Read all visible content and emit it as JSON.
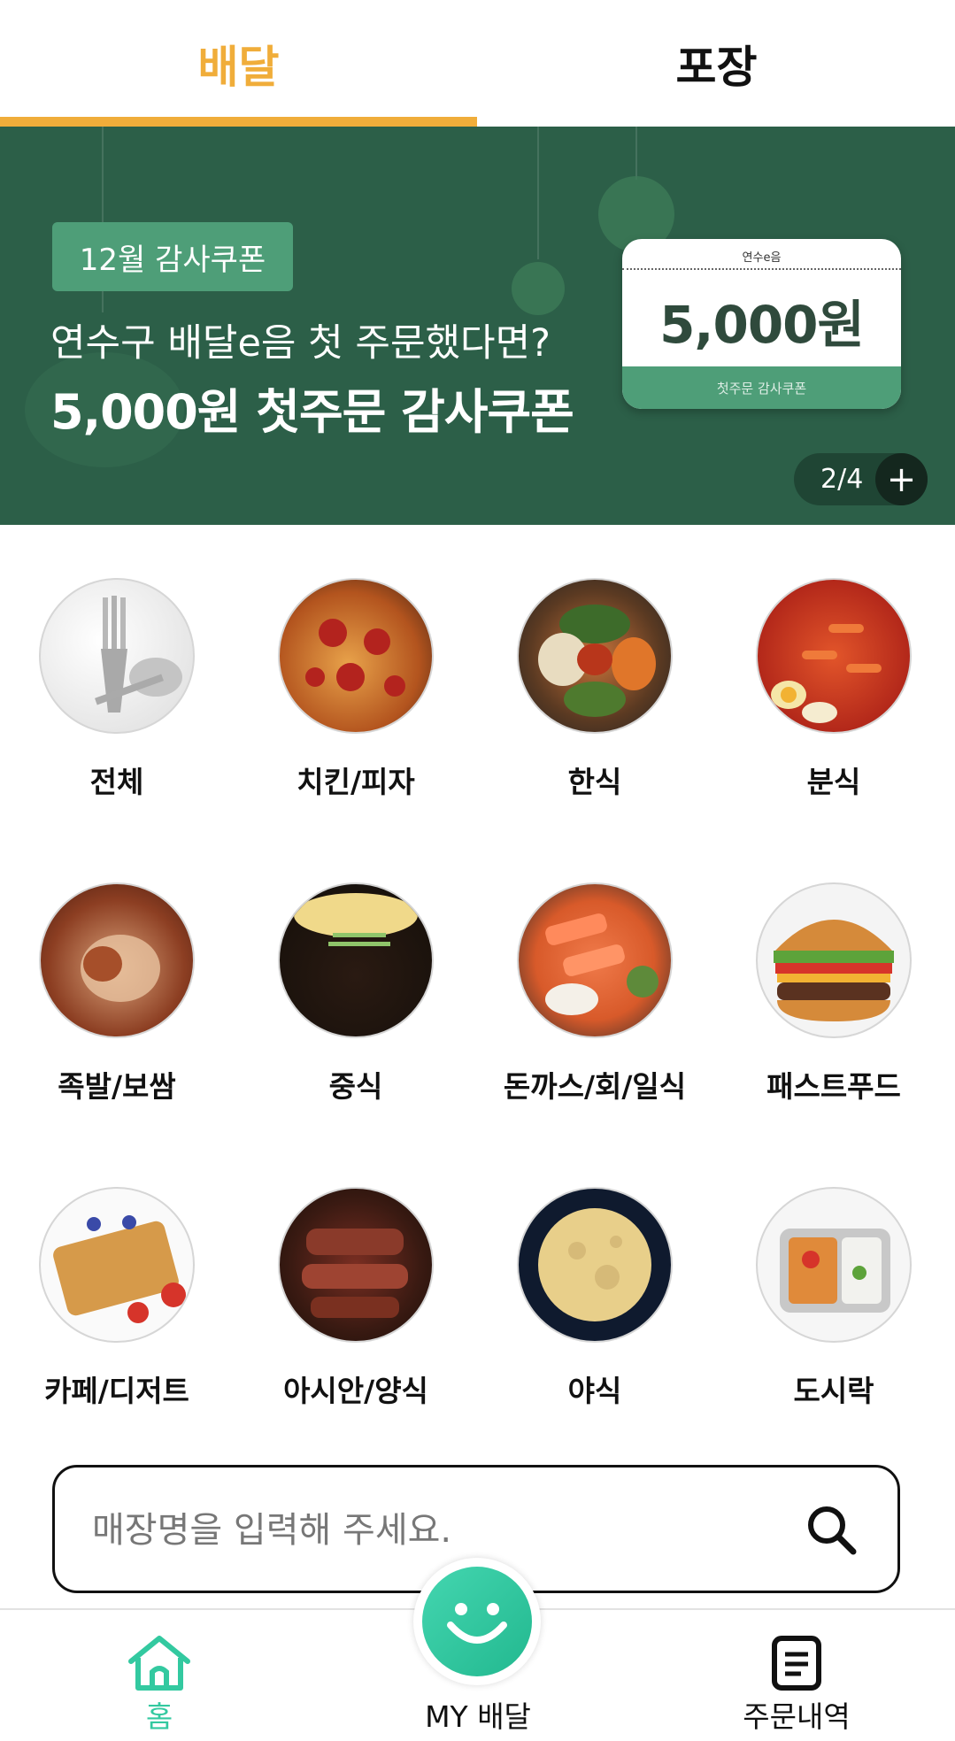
{
  "tabs": {
    "delivery": "배달",
    "pickup": "포장"
  },
  "banner": {
    "badge": "12월 감사쿠폰",
    "line1": "연수구 배달e음 첫 주문했다면?",
    "line2": "5,000원 첫주문 감사쿠폰",
    "coupon_top": "연수e음",
    "coupon_amount": "5,000원",
    "coupon_foot": "첫주문 감사쿠폰",
    "pager": "2/4",
    "pager_plus": "+"
  },
  "categories": [
    {
      "label": "전체",
      "icon": "fork-spoon-image"
    },
    {
      "label": "치킨/피자",
      "icon": "pizza-image"
    },
    {
      "label": "한식",
      "icon": "bibimbap-image"
    },
    {
      "label": "분식",
      "icon": "tteokbokki-image"
    },
    {
      "label": "족발/보쌈",
      "icon": "jokbal-image"
    },
    {
      "label": "중식",
      "icon": "jajangmyeon-image"
    },
    {
      "label": "돈까스/회/일식",
      "icon": "sashimi-image"
    },
    {
      "label": "패스트푸드",
      "icon": "burger-image"
    },
    {
      "label": "카페/디저트",
      "icon": "waffle-image"
    },
    {
      "label": "아시안/양식",
      "icon": "steak-image"
    },
    {
      "label": "야식",
      "icon": "moon-image"
    },
    {
      "label": "도시락",
      "icon": "lunchbox-image"
    }
  ],
  "search": {
    "placeholder": "매장명을 입력해 주세요."
  },
  "nav": {
    "home": "홈",
    "my": "MY 배달",
    "orders": "주문내역"
  },
  "colors": {
    "accent": "#f0ad3a",
    "banner_bg": "#2c5f48",
    "green": "#4e9e78",
    "mint": "#33c9a0"
  }
}
